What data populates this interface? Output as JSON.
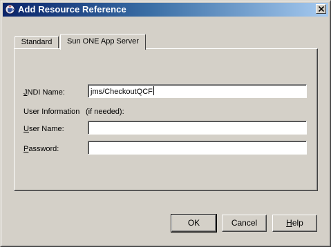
{
  "window": {
    "title": "Add Resource Reference",
    "title_icon": "java-cup-icon",
    "close_symbol": "close-icon"
  },
  "tabs": [
    {
      "label": "Standard",
      "active": false
    },
    {
      "label": "Sun ONE App Server",
      "active": true
    }
  ],
  "form": {
    "jndi_name": {
      "label_prefix": "",
      "label_mnemonic": "J",
      "label_rest": "NDI Name:",
      "value": "jms/CheckoutQCF"
    },
    "user_info": {
      "label": "User Information",
      "hint": "(if needed):"
    },
    "user_name": {
      "label_mnemonic": "U",
      "label_rest": "ser Name:",
      "value": ""
    },
    "password": {
      "label_mnemonic": "P",
      "label_rest": "assword:",
      "value": ""
    }
  },
  "buttons": {
    "ok": {
      "label": "OK",
      "mnemonic": "",
      "rest": "OK"
    },
    "cancel": {
      "label": "Cancel"
    },
    "help": {
      "mnemonic": "H",
      "rest": "elp"
    }
  },
  "colors": {
    "dialog_bg": "#d4d0c8",
    "title_start": "#0a246a",
    "title_end": "#a6caf0"
  }
}
